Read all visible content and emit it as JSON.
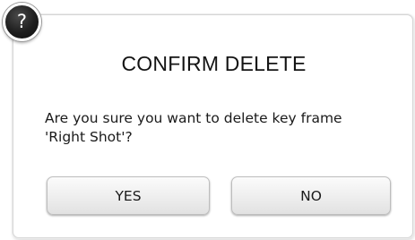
{
  "dialog": {
    "icon": "question-mark-icon",
    "icon_glyph": "?",
    "title": "CONFIRM DELETE",
    "message_line1": "Are you sure you want to delete key frame",
    "message_line2": "'Right Shot'?",
    "yes_label": "YES",
    "no_label": "NO"
  },
  "colors": {
    "icon_background": "#1e1e1e",
    "button_background": "#eeeeee",
    "text": "#1a1a1a"
  }
}
